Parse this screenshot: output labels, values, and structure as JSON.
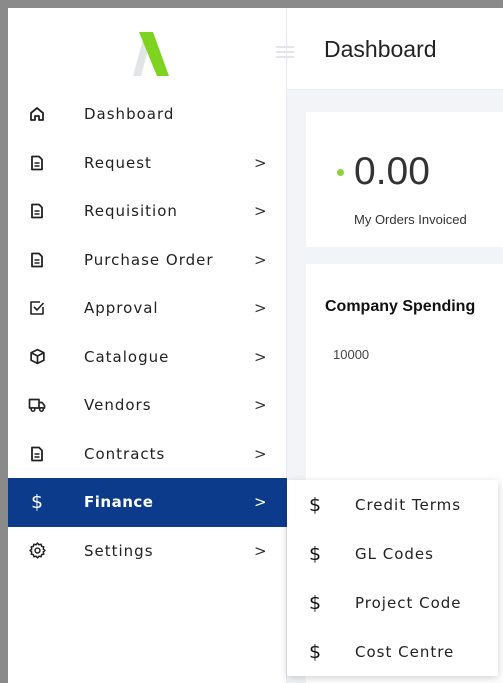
{
  "header": {
    "title": "Dashboard"
  },
  "sidebar": {
    "items": [
      {
        "label": "Dashboard",
        "icon": "home-icon",
        "chevron": ""
      },
      {
        "label": "Request",
        "icon": "document-icon",
        "chevron": ">"
      },
      {
        "label": "Requisition",
        "icon": "document-icon",
        "chevron": ">"
      },
      {
        "label": "Purchase Order",
        "icon": "document-icon",
        "chevron": ">"
      },
      {
        "label": "Approval",
        "icon": "checkbox-icon",
        "chevron": ">"
      },
      {
        "label": "Catalogue",
        "icon": "cube-icon",
        "chevron": ">"
      },
      {
        "label": "Vendors",
        "icon": "truck-icon",
        "chevron": ">"
      },
      {
        "label": "Contracts",
        "icon": "document-icon",
        "chevron": ">"
      },
      {
        "label": "Finance",
        "icon": "dollar-icon",
        "chevron": ">",
        "glyph": "$"
      },
      {
        "label": "Settings",
        "icon": "gear-icon",
        "chevron": ">"
      }
    ],
    "active_color": "#0d3b8c"
  },
  "submenu": {
    "items": [
      {
        "label": "Credit Terms",
        "glyph": "$"
      },
      {
        "label": "GL Codes",
        "glyph": "$"
      },
      {
        "label": "Project Code",
        "glyph": "$"
      },
      {
        "label": "Cost Centre",
        "glyph": "$"
      }
    ]
  },
  "stats": {
    "value": "0.00",
    "label": "My Orders Invoiced",
    "dot_color": "#8bd23a"
  },
  "spending": {
    "title": "Company Spending",
    "y_tick": "10000"
  },
  "brand": {
    "logo_color": "#7ed321"
  }
}
